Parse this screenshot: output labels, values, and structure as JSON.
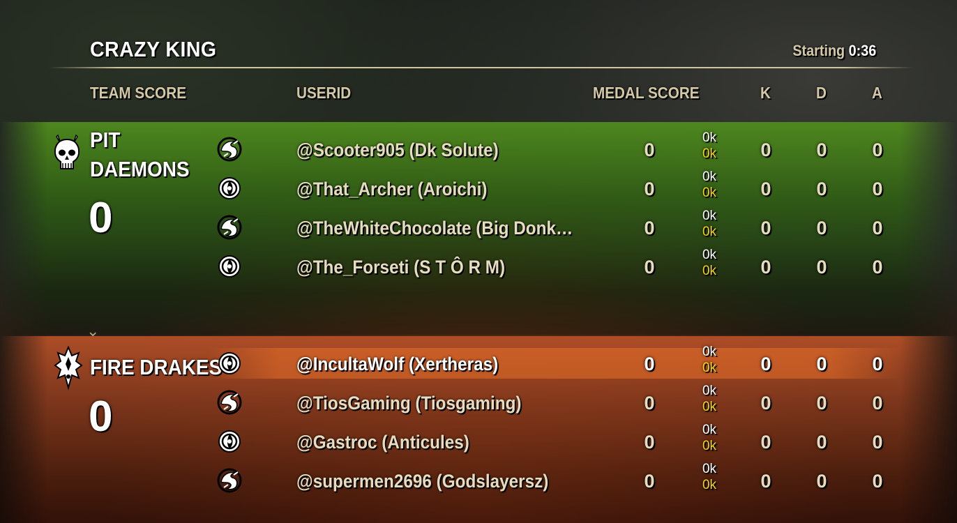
{
  "header": {
    "mode_title": "CRAZY KING",
    "status_label": "Starting",
    "timer": "0:36"
  },
  "columns": {
    "team_score": "TEAM SCORE",
    "userid": "USERID",
    "medal_score": "MEDAL SCORE",
    "k": "K",
    "d": "D",
    "a": "A"
  },
  "teams": [
    {
      "name_line1": "PIT",
      "name_line2": "DAEMONS",
      "score": "0",
      "color": "#5a9a24",
      "players": [
        {
          "user": "@Scooter905 (Dk Solute)",
          "class_icon": "dragonknight-icon",
          "medal": "0",
          "dmg": "0k",
          "heal": "0k",
          "k": "0",
          "d": "0",
          "a": "0"
        },
        {
          "user": "@That_Archer (Aroichi)",
          "class_icon": "templar-icon",
          "medal": "0",
          "dmg": "0k",
          "heal": "0k",
          "k": "0",
          "d": "0",
          "a": "0"
        },
        {
          "user": "@TheWhiteChocolate (Big Donk…",
          "class_icon": "dragonknight-icon",
          "medal": "0",
          "dmg": "0k",
          "heal": "0k",
          "k": "0",
          "d": "0",
          "a": "0"
        },
        {
          "user": "@The_Forseti (S T Ô R M)",
          "class_icon": "templar-icon",
          "medal": "0",
          "dmg": "0k",
          "heal": "0k",
          "k": "0",
          "d": "0",
          "a": "0"
        }
      ]
    },
    {
      "name_line1": "FIRE DRAKES",
      "name_line2": "",
      "score": "0",
      "color": "#b45028",
      "players": [
        {
          "user": "@IncultaWolf (Xertheras)",
          "class_icon": "templar-icon",
          "medal": "0",
          "dmg": "0k",
          "heal": "0k",
          "k": "0",
          "d": "0",
          "a": "0"
        },
        {
          "user": "@TiosGaming (Tiosgaming)",
          "class_icon": "dragonknight-icon",
          "medal": "0",
          "dmg": "0k",
          "heal": "0k",
          "k": "0",
          "d": "0",
          "a": "0"
        },
        {
          "user": "@Gastroc (Anticules)",
          "class_icon": "templar-icon",
          "medal": "0",
          "dmg": "0k",
          "heal": "0k",
          "k": "0",
          "d": "0",
          "a": "0"
        },
        {
          "user": "@supermen2696 (Godslayersz)",
          "class_icon": "dragonknight-icon",
          "medal": "0",
          "dmg": "0k",
          "heal": "0k",
          "k": "0",
          "d": "0",
          "a": "0"
        }
      ]
    }
  ]
}
